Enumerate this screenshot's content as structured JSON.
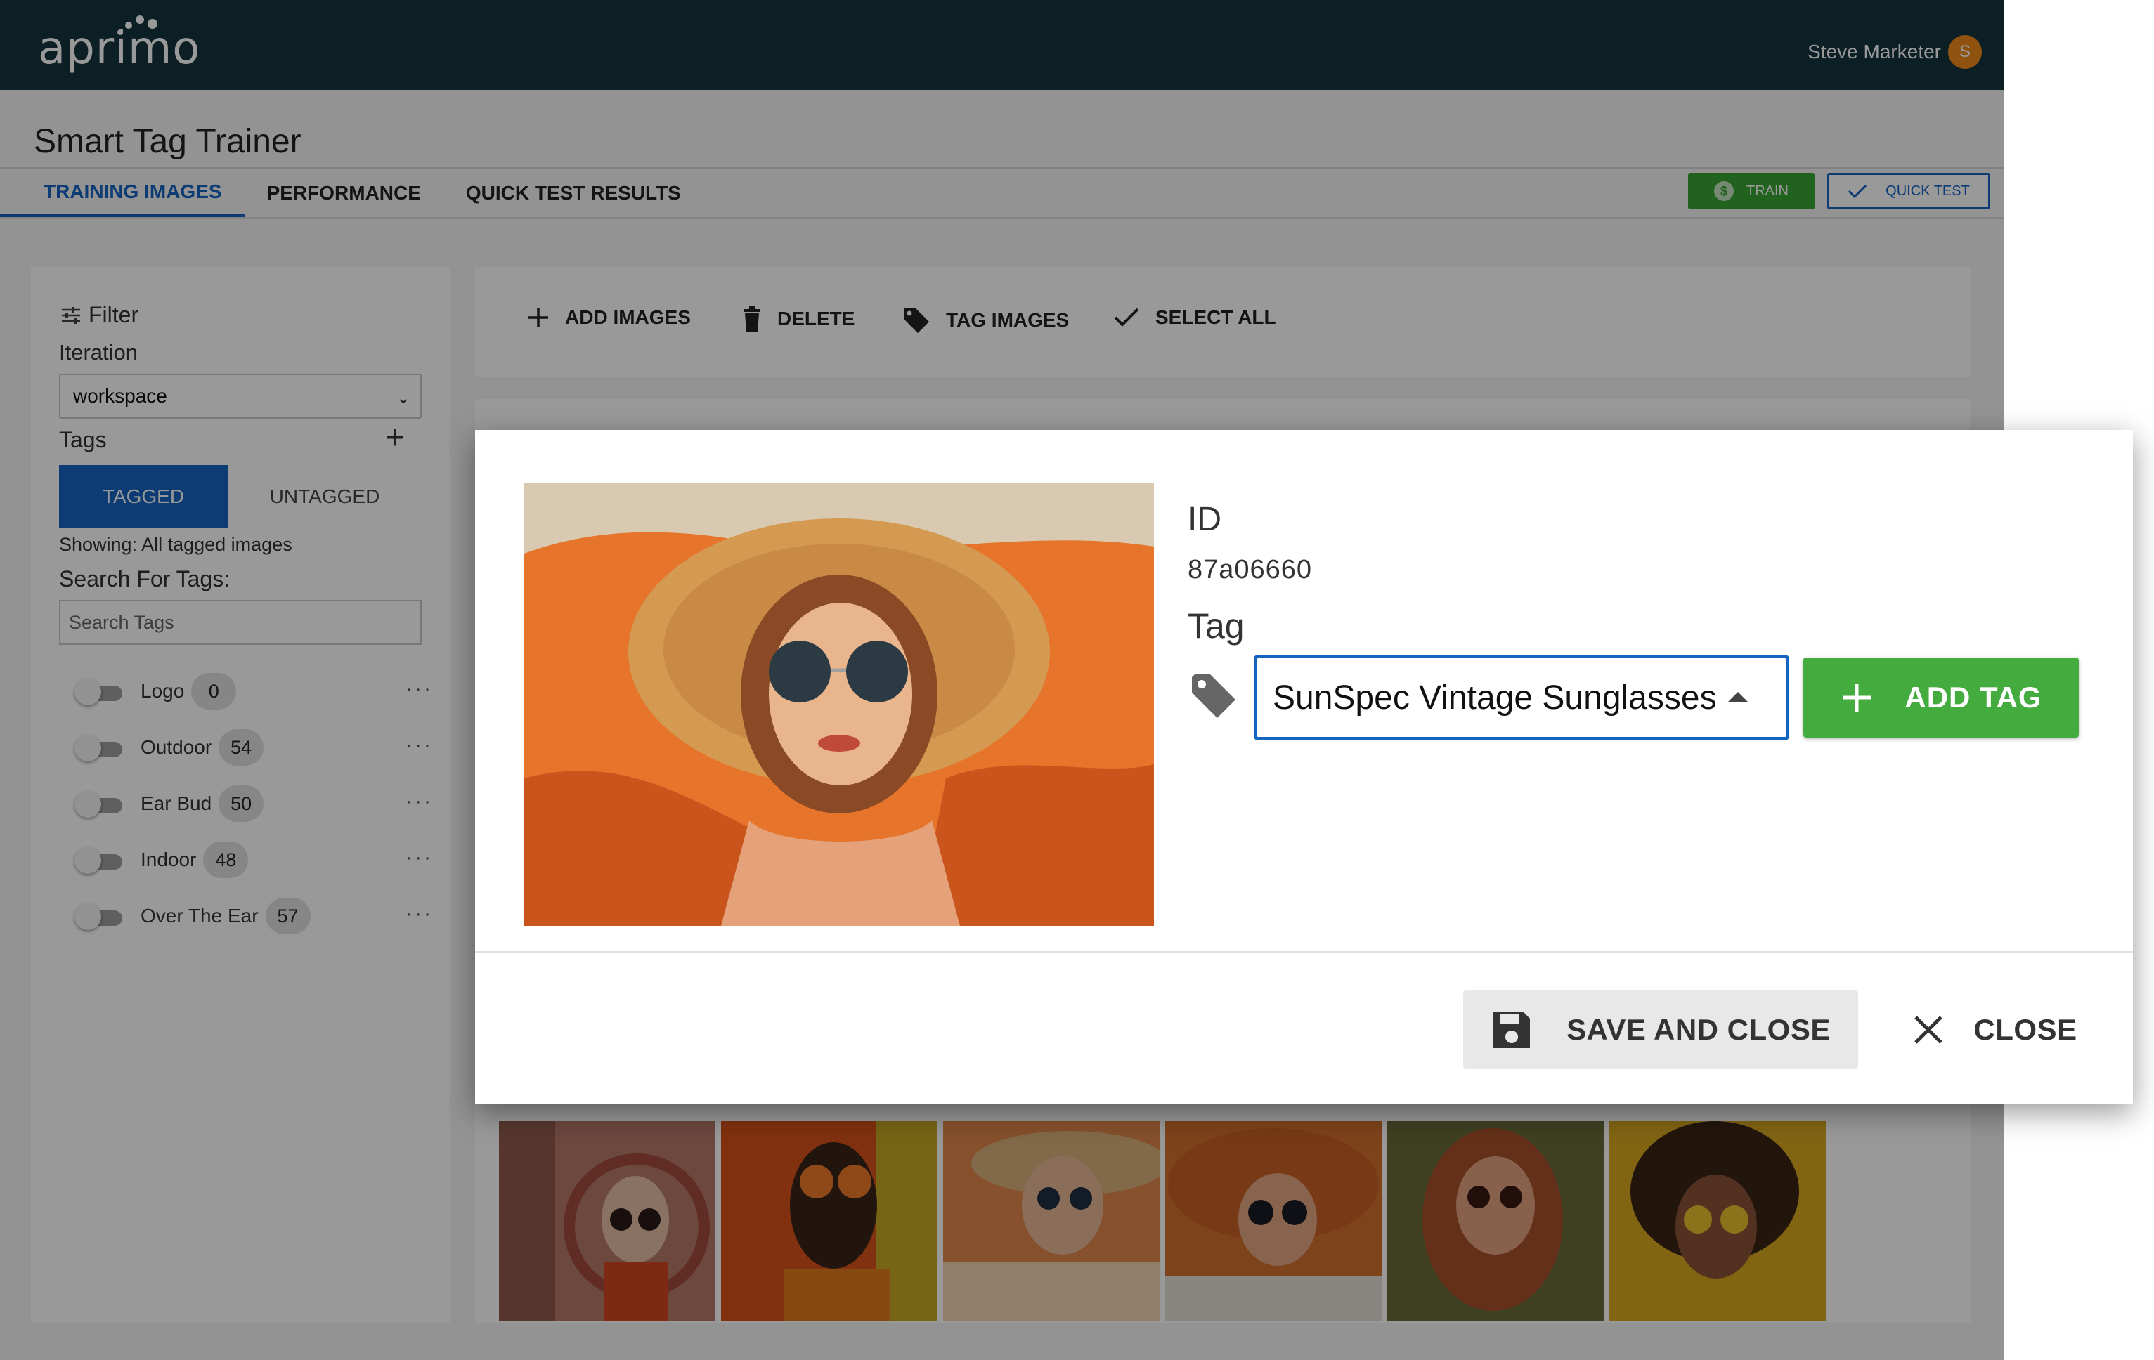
{
  "header": {
    "logo_text": "aprimo",
    "user_name": "Steve Marketer",
    "user_initial": "S"
  },
  "page": {
    "title": "Smart Tag Trainer",
    "tabs": [
      {
        "label": "TRAINING IMAGES",
        "active": true
      },
      {
        "label": "PERFORMANCE",
        "active": false
      },
      {
        "label": "QUICK TEST RESULTS",
        "active": false
      }
    ],
    "train_label": "TRAIN",
    "quick_test_label": "QUICK TEST"
  },
  "filter": {
    "title": "Filter",
    "iteration_label": "Iteration",
    "iteration_value": "workspace",
    "tags_label": "Tags",
    "tagged_label": "TAGGED",
    "untagged_label": "UNTAGGED",
    "showing_text": "Showing: All tagged images",
    "search_label": "Search For Tags:",
    "search_placeholder": "Search Tags",
    "tags": [
      {
        "name": "Logo",
        "count": "0"
      },
      {
        "name": "Outdoor",
        "count": "54"
      },
      {
        "name": "Ear Bud",
        "count": "50"
      },
      {
        "name": "Indoor",
        "count": "48"
      },
      {
        "name": "Over The Ear",
        "count": "57"
      }
    ],
    "more_text": "···"
  },
  "toolbar": {
    "add_images": "ADD IMAGES",
    "delete": "DELETE",
    "tag_images": "TAG IMAGES",
    "select_all": "SELECT ALL"
  },
  "dialog": {
    "id_label": "ID",
    "id_value": "87a06660",
    "tag_label": "Tag",
    "tag_value": "SunSpec Vintage Sunglasses",
    "add_tag_label": "ADD TAG",
    "save_close_label": "SAVE AND CLOSE",
    "close_label": "CLOSE"
  },
  "colors": {
    "topbar": "#14353f",
    "primary": "#1565c0",
    "success": "#44ab3e",
    "avatar": "#f08a1a"
  }
}
